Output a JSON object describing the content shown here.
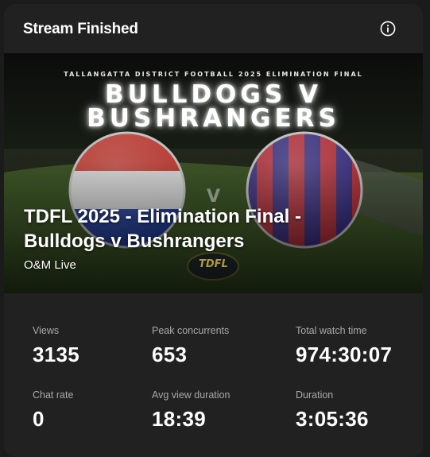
{
  "header": {
    "title": "Stream Finished",
    "info_icon": "info-icon"
  },
  "thumbnail": {
    "event_line": "TALLANGATTA DISTRICT FOOTBALL 2025 ELIMINATION FINAL",
    "team_line_1": "BULLDOGS V",
    "team_line_2": "BUSHRANGERS",
    "versus": "V",
    "logo_text": "TDFL",
    "colors": {
      "bulldogs_red": "#d33a2f",
      "bulldogs_blue": "#1f3fa8",
      "bushrangers_red": "#c72f3a",
      "bushrangers_blue": "#3a2f8c"
    }
  },
  "stream": {
    "title": "TDFL 2025 - Elimination Final - Bulldogs v Bushrangers",
    "channel": "O&M Live"
  },
  "stats": [
    {
      "label": "Views",
      "value": "3135"
    },
    {
      "label": "Peak concurrents",
      "value": "653"
    },
    {
      "label": "Total watch time",
      "value": "974:30:07"
    },
    {
      "label": "Chat rate",
      "value": "0"
    },
    {
      "label": "Avg view duration",
      "value": "18:39"
    },
    {
      "label": "Duration",
      "value": "3:05:36"
    }
  ]
}
